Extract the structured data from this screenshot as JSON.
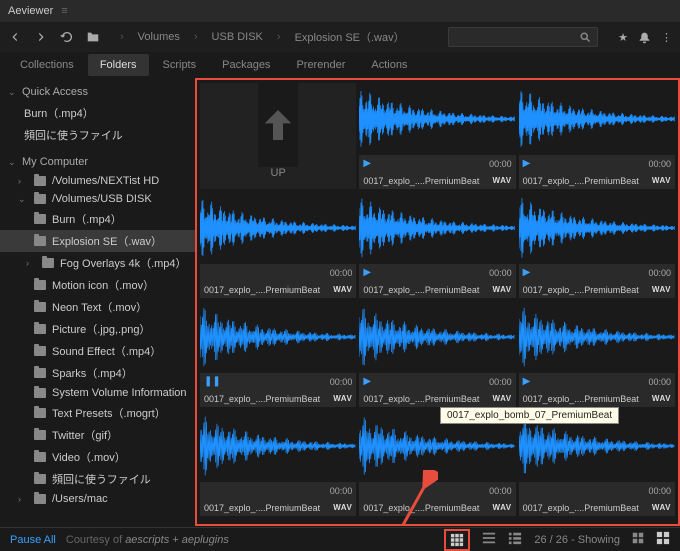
{
  "title": "Aeviewer",
  "breadcrumb": [
    "Volumes",
    "USB DISK",
    "Explosion SE（.wav）"
  ],
  "search_placeholder": "",
  "tabs": [
    "Collections",
    "Folders",
    "Scripts",
    "Packages",
    "Prerender",
    "Actions"
  ],
  "active_tab": "Folders",
  "sidebar": {
    "quick_access": "Quick Access",
    "quick_items": [
      "Burn（.mp4）",
      "頻回に使うファイル"
    ],
    "my_computer": "My Computer",
    "volumes": [
      {
        "name": "/Volumes/NEXTist HD",
        "expanded": false
      },
      {
        "name": "/Volumes/USB DISK",
        "expanded": true,
        "children": [
          {
            "name": "Burn（.mp4）"
          },
          {
            "name": "Explosion SE（.wav）",
            "active": true
          },
          {
            "name": "Fog Overlays 4k（.mp4）",
            "expandable": true
          },
          {
            "name": "Motion icon（.mov）"
          },
          {
            "name": "Neon Text（.mov）"
          },
          {
            "name": "Picture（.jpg,.png）"
          },
          {
            "name": "Sound Effect（.mp4）"
          },
          {
            "name": "Sparks（.mp4）"
          },
          {
            "name": "System Volume Information"
          },
          {
            "name": "Text Presets（.mogrt）"
          },
          {
            "name": "Twitter（gif）"
          },
          {
            "name": "Video（.mov）"
          },
          {
            "name": "頻回に使うファイル"
          }
        ]
      },
      {
        "name": "/Users/mac",
        "expanded": false
      }
    ]
  },
  "cells": [
    {
      "type": "up",
      "label": "UP"
    },
    {
      "name": "0017_explo_....PremiumBeat",
      "time": "00:00",
      "badge": "WAV",
      "play": "play"
    },
    {
      "name": "0017_explo_....PremiumBeat",
      "time": "00:00",
      "badge": "WAV",
      "play": "play"
    },
    {
      "name": "0017_explo_....PremiumBeat",
      "time": "00:00",
      "badge": "WAV"
    },
    {
      "name": "0017_explo_....PremiumBeat",
      "time": "00:00",
      "badge": "WAV",
      "play": "play"
    },
    {
      "name": "0017_explo_....PremiumBeat",
      "time": "00:00",
      "badge": "WAV",
      "play": "play"
    },
    {
      "name": "0017_explo_....PremiumBeat",
      "time": "00:00",
      "badge": "WAV",
      "play": "pause"
    },
    {
      "name": "0017_explo_....PremiumBeat",
      "time": "00:00",
      "badge": "WAV",
      "play": "play"
    },
    {
      "name": "0017_explo_....PremiumBeat",
      "time": "00:00",
      "badge": "WAV",
      "play": "play"
    },
    {
      "name": "0017_explo_....PremiumBeat",
      "time": "00:00",
      "badge": "WAV"
    },
    {
      "name": "0017_explo_....PremiumBeat",
      "time": "00:00",
      "badge": "WAV"
    },
    {
      "name": "0017_explo_....PremiumBeat",
      "time": "00:00",
      "badge": "WAV"
    }
  ],
  "tooltip": "0017_explo_bomb_07_PremiumBeat",
  "status": {
    "pause_all": "Pause All",
    "courtesy": "Courtesy of",
    "brand": "aescripts + aeplugins",
    "showing": "26 / 26 - Showing"
  }
}
